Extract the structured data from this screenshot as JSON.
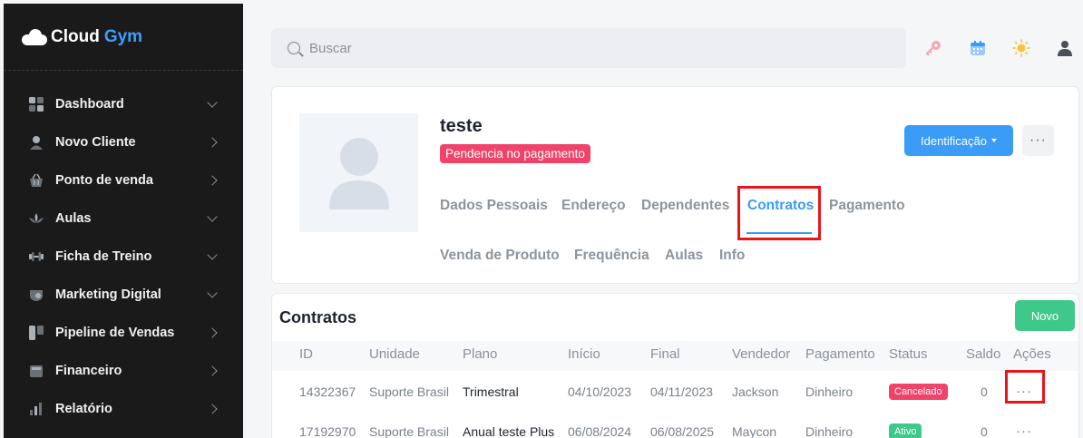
{
  "brand": {
    "part1": "Cloud",
    "part2": "Gym"
  },
  "sidebar": {
    "items": [
      {
        "label": "Dashboard",
        "icon": "dashboard-icon",
        "arrow": "down"
      },
      {
        "label": "Novo Cliente",
        "icon": "user-icon",
        "arrow": "right"
      },
      {
        "label": "Ponto de venda",
        "icon": "basket-icon",
        "arrow": "right"
      },
      {
        "label": "Aulas",
        "icon": "lotus-icon",
        "arrow": "down"
      },
      {
        "label": "Ficha de Treino",
        "icon": "dumbbell-icon",
        "arrow": "down"
      },
      {
        "label": "Marketing Digital",
        "icon": "marketing-icon",
        "arrow": "down"
      },
      {
        "label": "Pipeline de Vendas",
        "icon": "pipeline-icon",
        "arrow": "right"
      },
      {
        "label": "Financeiro",
        "icon": "wallet-icon",
        "arrow": "right"
      },
      {
        "label": "Relatório",
        "icon": "chart-icon",
        "arrow": "right"
      }
    ]
  },
  "search": {
    "placeholder": "Buscar"
  },
  "topbar_icons": [
    "key-icon",
    "calendar-icon",
    "sun-icon",
    "user-icon"
  ],
  "profile": {
    "name": "teste",
    "status_badge": "Pendencia no pagamento",
    "ident_button": "Identificação",
    "more_button": "···",
    "tabs_row1": [
      "Dados Pessoais",
      "Endereço",
      "Dependentes",
      "Contratos",
      "Pagamento"
    ],
    "tabs_row2": [
      "Venda de Produto",
      "Frequência",
      "Aulas",
      "Info"
    ],
    "active_tab": "Contratos"
  },
  "contracts": {
    "title": "Contratos",
    "new_button": "Novo",
    "columns": [
      "ID",
      "Unidade",
      "Plano",
      "Início",
      "Final",
      "Vendedor",
      "Pagamento",
      "Status",
      "Saldo",
      "Ações"
    ],
    "rows": [
      {
        "id": "14322367",
        "unidade": "Suporte Brasil",
        "plano": "Trimestral",
        "inicio": "04/10/2023",
        "final": "04/11/2023",
        "vendedor": "Jackson",
        "pagamento": "Dinheiro",
        "status": "Cancelado",
        "saldo": "0",
        "acoes": "···"
      },
      {
        "id": "17192970",
        "unidade": "Suporte Brasil",
        "plano": "Anual teste Plus",
        "inicio": "06/08/2024",
        "final": "06/08/2025",
        "vendedor": "Maycon",
        "pagamento": "Dinheiro",
        "status": "Ativo",
        "saldo": "0",
        "acoes": "···"
      }
    ]
  },
  "colors": {
    "accent": "#3a9cf7",
    "danger": "#f0436a",
    "success": "#3ec88a",
    "sidebar_bg": "#1a1a1a",
    "highlight": "#e8151b"
  }
}
